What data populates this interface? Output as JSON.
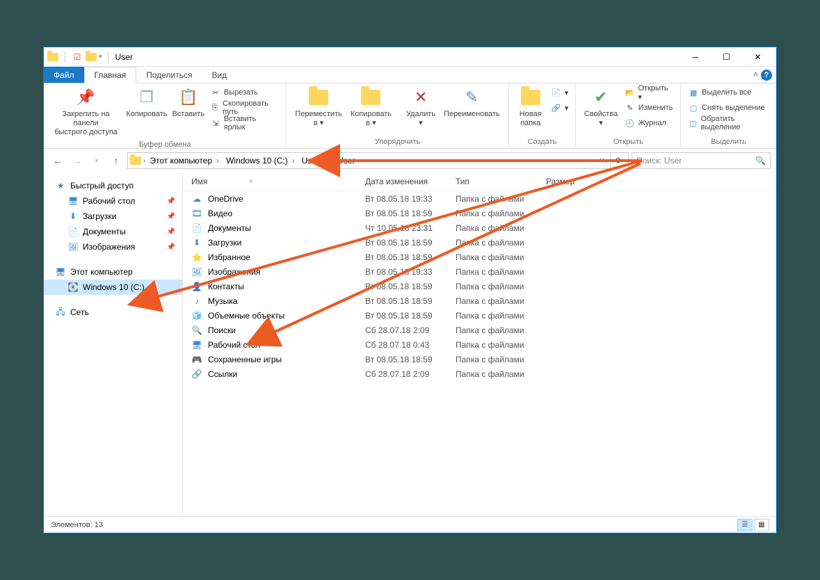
{
  "title": "User",
  "tabs": {
    "file": "Файл",
    "home": "Главная",
    "share": "Поделиться",
    "view": "Вид"
  },
  "ribbon": {
    "clipboard": {
      "pin": "Закрепить на панели\nбыстрого доступа",
      "copy": "Копировать",
      "paste": "Вставить",
      "cut": "Вырезать",
      "copypath": "Скопировать путь",
      "pastelnk": "Вставить ярлык",
      "label": "Буфер обмена"
    },
    "organize": {
      "moveto": "Переместить\nв ▾",
      "copyto": "Копировать\nв ▾",
      "delete": "Удалить\n▾",
      "rename": "Переименовать",
      "label": "Упорядочить"
    },
    "new": {
      "newfolder": "Новая\nпапка",
      "label": "Создать"
    },
    "open": {
      "properties": "Свойства\n▾",
      "open": "Открыть ▾",
      "edit": "Изменить",
      "history": "Журнал",
      "label": "Открыть"
    },
    "select": {
      "all": "Выделить все",
      "none": "Снять выделение",
      "invert": "Обратить выделение",
      "label": "Выделить"
    }
  },
  "breadcrumb": [
    "Этот компьютер",
    "Windows 10 (C:)",
    "Users",
    "User"
  ],
  "search_placeholder": "Поиск: User",
  "nav": {
    "quick": "Быстрый доступ",
    "quick_items": [
      {
        "label": "Рабочий стол",
        "pin": true,
        "icon": "desktop"
      },
      {
        "label": "Загрузки",
        "pin": true,
        "icon": "downloads"
      },
      {
        "label": "Документы",
        "pin": true,
        "icon": "documents"
      },
      {
        "label": "Изображения",
        "pin": true,
        "icon": "pictures"
      }
    ],
    "thispc": "Этот компьютер",
    "drive": "Windows 10 (C:)",
    "network": "Сеть"
  },
  "columns": {
    "name": "Имя",
    "date": "Дата изменения",
    "type": "Тип",
    "size": "Размер"
  },
  "files": [
    {
      "name": "OneDrive",
      "date": "Вт 08.05.18 19:33",
      "type": "Папка с файлами",
      "icon": "cloud"
    },
    {
      "name": "Видео",
      "date": "Вт 08.05.18 18:59",
      "type": "Папка с файлами",
      "icon": "video"
    },
    {
      "name": "Документы",
      "date": "Чт 10.05.18 23:31",
      "type": "Папка с файлами",
      "icon": "documents"
    },
    {
      "name": "Загрузки",
      "date": "Вт 08.05.18 18:59",
      "type": "Папка с файлами",
      "icon": "downloads"
    },
    {
      "name": "Избранное",
      "date": "Вт 08.05.18 18:59",
      "type": "Папка с файлами",
      "icon": "star"
    },
    {
      "name": "Изображения",
      "date": "Вт 08.05.18 19:33",
      "type": "Папка с файлами",
      "icon": "pictures"
    },
    {
      "name": "Контакты",
      "date": "Вт 08.05.18 18:59",
      "type": "Папка с файлами",
      "icon": "contacts"
    },
    {
      "name": "Музыка",
      "date": "Вт 08.05.18 18:59",
      "type": "Папка с файлами",
      "icon": "music"
    },
    {
      "name": "Объемные объекты",
      "date": "Вт 08.05.18 18:59",
      "type": "Папка с файлами",
      "icon": "3d"
    },
    {
      "name": "Поиски",
      "date": "Сб 28.07.18 2:09",
      "type": "Папка с файлами",
      "icon": "search"
    },
    {
      "name": "Рабочий стол",
      "date": "Сб 28.07.18 0:43",
      "type": "Папка с файлами",
      "icon": "desktop"
    },
    {
      "name": "Сохраненные игры",
      "date": "Вт 08.05.18 18:59",
      "type": "Папка с файлами",
      "icon": "games"
    },
    {
      "name": "Ссылки",
      "date": "Сб 28.07.18 2:09",
      "type": "Папка с файлами",
      "icon": "links"
    }
  ],
  "status": "Элементов: 13"
}
